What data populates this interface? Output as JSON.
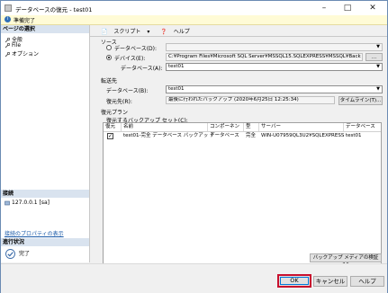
{
  "window": {
    "title": "データベースの復元 - test01",
    "minimize_icon": "minimize-icon",
    "maximize_icon": "maximize-icon",
    "close_icon": "close-icon"
  },
  "status": {
    "text": "準備完了"
  },
  "sidebar": {
    "pages_header": "ページの選択",
    "items": [
      {
        "label": "全般",
        "icon": "wrench-icon"
      },
      {
        "label": "File",
        "icon": "wrench-icon"
      },
      {
        "label": "オプション",
        "icon": "wrench-icon"
      }
    ],
    "connection_header": "接続",
    "connection_value": "127.0.0.1 [sa]",
    "connection_link": "接続のプロパティの表示",
    "progress_header": "進行状況",
    "progress_text": "完了"
  },
  "toolbar": {
    "script_label": "スクリプト",
    "script_arrow": "▾",
    "help_label": "ヘルプ"
  },
  "source": {
    "header": "ソース",
    "database_radio": "データベース(D):",
    "device_radio": "デバイス(E):",
    "device_path": "C:¥Program Files¥Microsoft SQL Server¥MSSQL15.SQLEXPRESS¥MSSQL¥Back",
    "browse_button": "...",
    "database_label": "データベース(A):",
    "database_value": "test01"
  },
  "destination": {
    "header": "転送先",
    "database_label": "データベース(B):",
    "database_value": "test01",
    "restore_to_label": "復元先(R):",
    "restore_to_value": "最後に行われたバックアップ (2020年6月25日 12:25:34)",
    "timeline_button": "タイムライン(T)..."
  },
  "plan": {
    "header": "復元プラン",
    "sets_label": "復元するバックアップ セット(C):",
    "columns": [
      "復元",
      "名前",
      "コンポーネント",
      "型",
      "サーバー",
      "データベース"
    ],
    "rows": [
      {
        "checked": true,
        "name": "test01-完全 データベース バックアップ",
        "component": "データベース",
        "type": "完全",
        "server": "WIN-U07959QL3U2¥SQLEXPRESS",
        "database": "test01"
      }
    ],
    "verify_button": "バックアップ メディアの検証(V)"
  },
  "footer": {
    "ok": "OK",
    "cancel": "キャンセル",
    "help": "ヘルプ"
  }
}
